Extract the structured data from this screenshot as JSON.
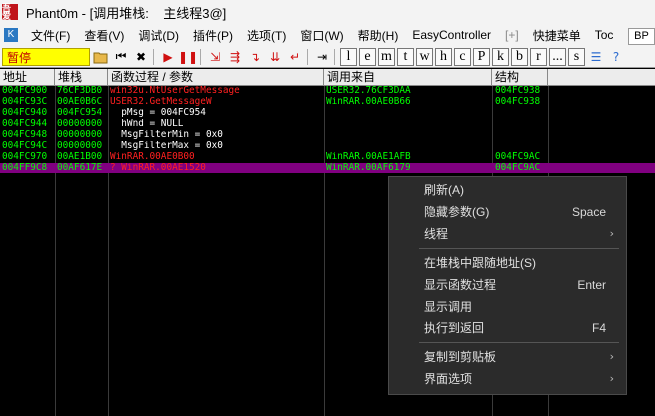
{
  "window": {
    "app_icon_text": "吾爱",
    "title": "Phant0m - [调用堆栈:    主线程3@]"
  },
  "menu": {
    "system_icon": "K",
    "items": [
      {
        "label": "文件(F)",
        "disabled": false
      },
      {
        "label": "查看(V)",
        "disabled": false
      },
      {
        "label": "调试(D)",
        "disabled": false
      },
      {
        "label": "插件(P)",
        "disabled": false
      },
      {
        "label": "选项(T)",
        "disabled": false
      },
      {
        "label": "窗口(W)",
        "disabled": false
      },
      {
        "label": "帮助(H)",
        "disabled": false
      },
      {
        "label": "EasyController",
        "disabled": false
      },
      {
        "label": "[+]",
        "disabled": true
      },
      {
        "label": "快捷菜单",
        "disabled": false
      },
      {
        "label": "Toc",
        "disabled": false
      }
    ],
    "bp_button": "BP"
  },
  "toolbar": {
    "status": "暂停",
    "letters": [
      "l",
      "e",
      "m",
      "t",
      "w",
      "h",
      "c",
      "P",
      "k",
      "b",
      "r",
      "...",
      "s"
    ]
  },
  "columns": {
    "address": "地址",
    "stack": "堆栈",
    "procedure": "函数过程 / 参数",
    "called_from": "调用来自",
    "frame": "结构"
  },
  "rows": [
    {
      "address": "004FC900",
      "stack": "76CF3DB0",
      "procedure": "win32u.NtUserGetMessage",
      "called_from": "USER32.76CF3DAA",
      "frame": "004FC938",
      "proc_color": "red",
      "selected": false
    },
    {
      "address": "004FC93C",
      "stack": "00AE0B6C",
      "procedure": "USER32.GetMessageW",
      "called_from": "WinRAR.00AE0B66",
      "frame": "004FC938",
      "proc_color": "red",
      "selected": false
    },
    {
      "address": "004FC940",
      "stack": "004FC954",
      "procedure": "  pMsg = 004FC954",
      "called_from": "",
      "frame": "",
      "proc_color": "white",
      "selected": false
    },
    {
      "address": "004FC944",
      "stack": "00000000",
      "procedure": "  hWnd = NULL",
      "called_from": "",
      "frame": "",
      "proc_color": "white",
      "selected": false
    },
    {
      "address": "004FC948",
      "stack": "00000000",
      "procedure": "  MsgFilterMin = 0x0",
      "called_from": "",
      "frame": "",
      "proc_color": "white",
      "selected": false
    },
    {
      "address": "004FC94C",
      "stack": "00000000",
      "procedure": "  MsgFilterMax = 0x0",
      "called_from": "",
      "frame": "",
      "proc_color": "white",
      "selected": false
    },
    {
      "address": "004FC970",
      "stack": "00AE1B00",
      "procedure": "WinRAR.00AE0B00",
      "called_from": "WinRAR.00AE1AFB",
      "frame": "004FC9AC",
      "proc_color": "red",
      "selected": false
    },
    {
      "address": "004FF9C8",
      "stack": "00AF617E",
      "procedure": "? WinRAR.00AE1520",
      "called_from": "WinRAR.00AF6179",
      "frame": "004FC9AC",
      "proc_color": "red",
      "selected": true
    }
  ],
  "context_menu": {
    "items": [
      {
        "label": "刷新(A)",
        "shortcut": "",
        "submenu": false
      },
      {
        "label": "隐藏参数(G)",
        "shortcut": "Space",
        "submenu": false
      },
      {
        "label": "线程",
        "shortcut": "",
        "submenu": true
      },
      {
        "label": "在堆栈中跟随地址(S)",
        "shortcut": "",
        "submenu": false
      },
      {
        "label": "显示函数过程",
        "shortcut": "Enter",
        "submenu": false
      },
      {
        "label": "显示调用",
        "shortcut": "",
        "submenu": false
      },
      {
        "label": "执行到返回",
        "shortcut": "F4",
        "submenu": false
      },
      {
        "label": "复制到剪贴板",
        "shortcut": "",
        "submenu": true
      },
      {
        "label": "界面选项",
        "shortcut": "",
        "submenu": true
      }
    ]
  },
  "colors": {
    "addr_text": "#00ff00",
    "proc_red": "#ff2020",
    "selected_row": "#800080",
    "status_bg": "#ffff00",
    "context_bg": "#2b2b2b"
  }
}
